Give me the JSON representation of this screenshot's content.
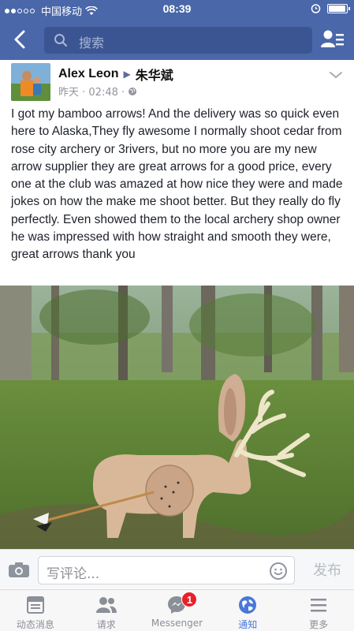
{
  "status_bar": {
    "carrier": "中国移动",
    "time": "08:39",
    "battery_level": 0.95
  },
  "nav": {
    "search_placeholder": "搜索"
  },
  "post": {
    "author": "Alex Leon",
    "target": "朱华斌",
    "timestamp": "昨天 · 02:48 ·",
    "text": "I got my bamboo arrows! And the delivery was so quick even here to Alaska,They fly awesome I normally shoot cedar from rose city archery or 3rivers, but no more you are my new arrow supplier they are great arrows for a good price, every one at the club was amazed at how nice they were and made jokes on how the make me shoot better. But they really do fly perfectly. Even showed them to the local archery shop owner he was impressed with how straight and smooth they were, great arrows thank you"
  },
  "comment_bar": {
    "placeholder": "写评论...",
    "publish_label": "发布"
  },
  "tabs": [
    {
      "label": "动态消息",
      "icon": "news-feed-icon"
    },
    {
      "label": "请求",
      "icon": "friend-requests-icon"
    },
    {
      "label": "Messenger",
      "icon": "messenger-icon",
      "badge": "1"
    },
    {
      "label": "通知",
      "icon": "globe-icon",
      "active": true
    },
    {
      "label": "更多",
      "icon": "menu-icon"
    }
  ],
  "colors": {
    "header": "#4a67a9",
    "active_tab": "#4a78d9",
    "badge": "#e9202a"
  }
}
